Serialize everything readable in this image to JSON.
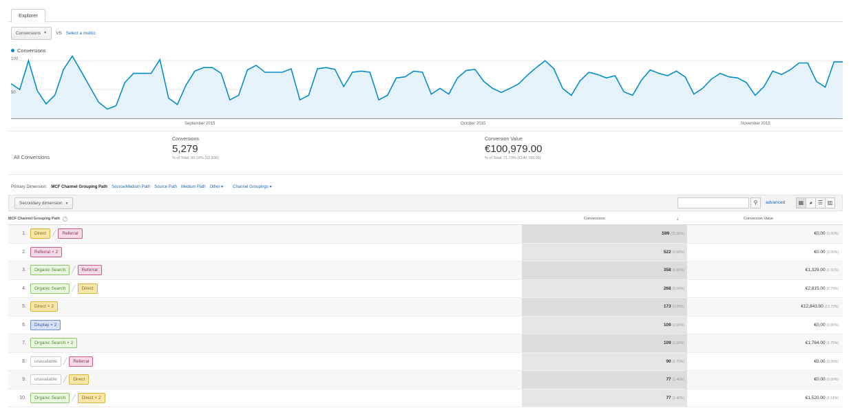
{
  "tab": {
    "label": "Explorer"
  },
  "metric": {
    "selected": "Conversions",
    "vs": "VS",
    "select_link": "Select a metric"
  },
  "chart_data": {
    "type": "area",
    "series": [
      {
        "name": "Conversions",
        "color": "#058dc7"
      }
    ],
    "y_ticks": [
      "100",
      "50"
    ],
    "ylim": [
      0,
      105
    ],
    "x_labels": [
      "September 2015",
      "October 2015",
      "November 2015"
    ],
    "values": [
      60,
      50,
      100,
      48,
      25,
      40,
      85,
      108,
      82,
      55,
      28,
      16,
      22,
      62,
      78,
      78,
      78,
      102,
      35,
      24,
      58,
      82,
      88,
      88,
      78,
      32,
      40,
      84,
      92,
      80,
      80,
      80,
      86,
      32,
      40,
      86,
      88,
      85,
      55,
      80,
      82,
      80,
      32,
      40,
      70,
      72,
      82,
      80,
      42,
      52,
      42,
      70,
      83,
      85,
      64,
      52,
      45,
      52,
      60,
      75,
      88,
      100,
      86,
      52,
      40,
      65,
      80,
      76,
      70,
      74,
      46,
      40,
      66,
      84,
      78,
      74,
      82,
      72,
      42,
      52,
      68,
      78,
      72,
      70,
      62,
      40,
      55,
      82,
      76,
      84,
      96,
      96,
      64,
      54,
      98,
      98
    ]
  },
  "summary": {
    "all_label": "All Conversions",
    "conversions": {
      "label": "Conversions",
      "value": "5,279",
      "sub": "% of Total: 93.10% (10,836)"
    },
    "conversion_value": {
      "label": "Conversion Value",
      "value": "€100,979.00",
      "sub": "% of Total: 71.73% (€140,783.00)"
    }
  },
  "dimensions": {
    "prefix": "Primary Dimension:",
    "active": "MCF Channel Grouping Path",
    "links": [
      "Source/Medium Path",
      "Source Path",
      "Medium Path",
      "Other ▾",
      "Channel Groupings ▾"
    ]
  },
  "toolbar": {
    "secondary": "Secondary dimension",
    "search_placeholder": "",
    "advanced": "advanced"
  },
  "table": {
    "headers": {
      "path": "MCF Channel Grouping Path",
      "conversions": "Conversions",
      "value": "Conversion Value"
    },
    "rows": [
      {
        "rank": "1.",
        "path": [
          {
            "label": "Direct",
            "kind": "direct"
          },
          {
            "label": "Referral",
            "kind": "referral"
          }
        ],
        "conversions": "599",
        "conv_pct": "(11.35%)",
        "value": "€0.00",
        "val_pct": "(0.00%)"
      },
      {
        "rank": "2.",
        "path": [
          {
            "label": "Referral × 2",
            "kind": "referral"
          }
        ],
        "conversions": "522",
        "conv_pct": "(9.89%)",
        "value": "€0.00",
        "val_pct": "(0.00%)"
      },
      {
        "rank": "3.",
        "path": [
          {
            "label": "Organic Search",
            "kind": "organic"
          },
          {
            "label": "Referral",
            "kind": "referral"
          }
        ],
        "conversions": "358",
        "conv_pct": "(6.93%)",
        "value": "€1,329.00",
        "val_pct": "(1.31%)"
      },
      {
        "rank": "4.",
        "path": [
          {
            "label": "Organic Search",
            "kind": "organic"
          },
          {
            "label": "Direct",
            "kind": "direct"
          }
        ],
        "conversions": "268",
        "conv_pct": "(5.04%)",
        "value": "€2,815.00",
        "val_pct": "(2.79%)"
      },
      {
        "rank": "5.",
        "path": [
          {
            "label": "Direct × 2",
            "kind": "direct"
          }
        ],
        "conversions": "173",
        "conv_pct": "(3.28%)",
        "value": "€12,843.00",
        "val_pct": "(12.72%)"
      },
      {
        "rank": "6.",
        "path": [
          {
            "label": "Display × 2",
            "kind": "display"
          }
        ],
        "conversions": "109",
        "conv_pct": "(2.06%)",
        "value": "€0.00",
        "val_pct": "(0.00%)"
      },
      {
        "rank": "7.",
        "path": [
          {
            "label": "Organic Search × 2",
            "kind": "organic"
          }
        ],
        "conversions": "109",
        "conv_pct": "(2.06%)",
        "value": "€1,764.00",
        "val_pct": "(1.75%)"
      },
      {
        "rank": "8.",
        "path": [
          {
            "label": "unavailable",
            "kind": "unavail"
          },
          {
            "label": "Referral",
            "kind": "referral"
          }
        ],
        "conversions": "90",
        "conv_pct": "(1.70%)",
        "value": "€0.00",
        "val_pct": "(0.00%)"
      },
      {
        "rank": "9.",
        "path": [
          {
            "label": "unavailable",
            "kind": "unavail"
          },
          {
            "label": "Direct",
            "kind": "direct"
          }
        ],
        "conversions": "77",
        "conv_pct": "(1.46%)",
        "value": "€0.00",
        "val_pct": "(0.00%)"
      },
      {
        "rank": "10.",
        "path": [
          {
            "label": "Organic Search",
            "kind": "organic"
          },
          {
            "label": "Direct × 2",
            "kind": "direct"
          }
        ],
        "conversions": "77",
        "conv_pct": "(1.46%)",
        "value": "€1,520.00",
        "val_pct": "(1.51%)"
      }
    ]
  }
}
